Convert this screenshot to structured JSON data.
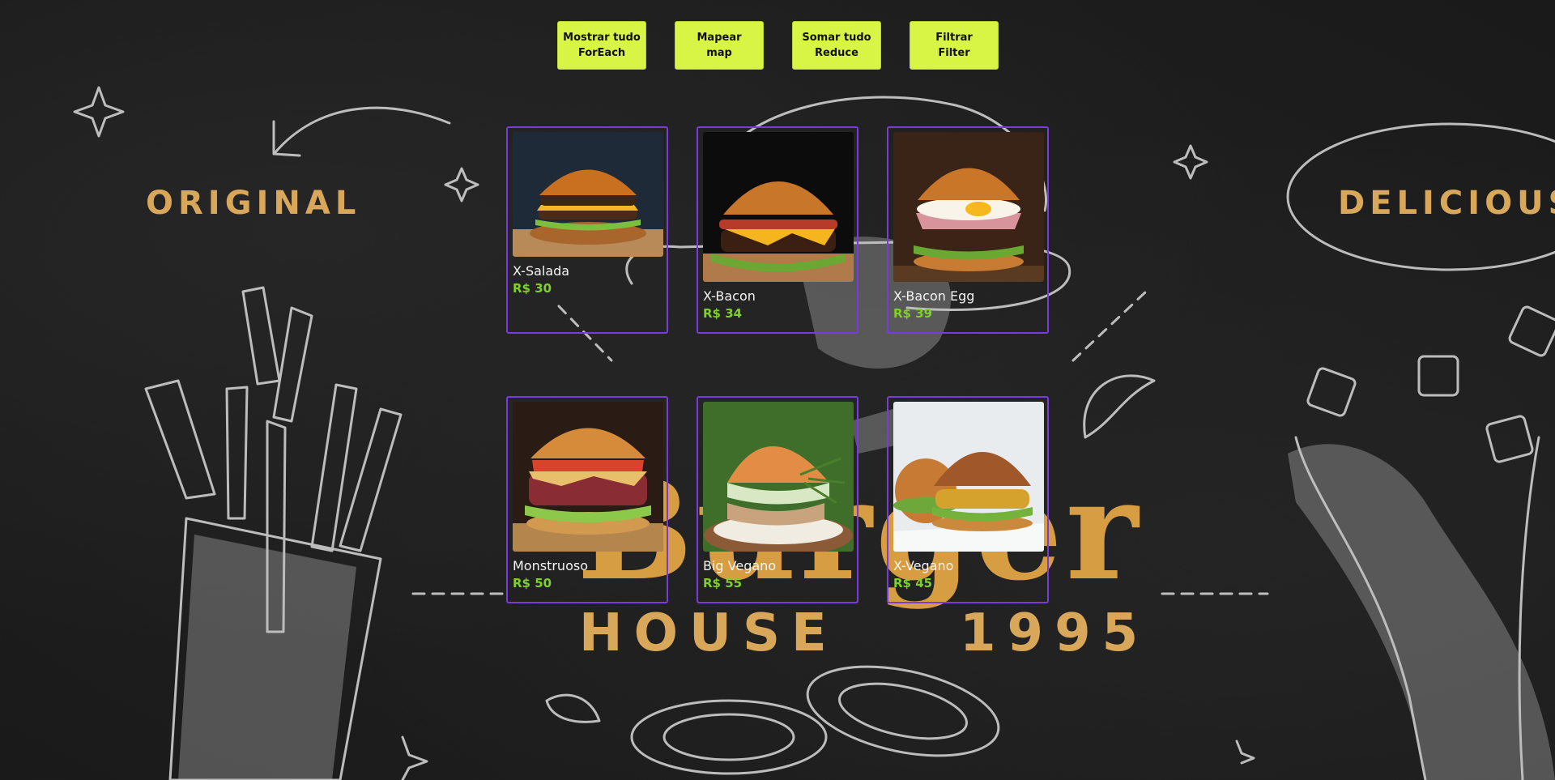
{
  "colors": {
    "button_bg": "#d8f545",
    "card_border": "#7b3bdb",
    "price_text": "#7fd12a",
    "background": "#1d1d1d",
    "chalk_accent": "#d9a75a"
  },
  "background_art": {
    "word_original": "ORIGINAL",
    "word_delicious": "DELICIOUS",
    "word_burger": "Burger",
    "word_house": "HOUSE",
    "word_year": "1995"
  },
  "buttons": [
    {
      "line1": "Mostrar tudo",
      "line2": "ForEach"
    },
    {
      "line1": "Mapear",
      "line2": "map"
    },
    {
      "line1": "Somar tudo",
      "line2": "Reduce"
    },
    {
      "line1": "Filtrar",
      "line2": "Filter"
    }
  ],
  "products": [
    {
      "name": "X-Salada",
      "price": "R$ 30",
      "photo_icon": "burger-salad-photo"
    },
    {
      "name": "X-Bacon",
      "price": "R$ 34",
      "photo_icon": "burger-bacon-photo"
    },
    {
      "name": "X-Bacon Egg",
      "price": "R$ 39",
      "photo_icon": "burger-bacon-egg-photo"
    },
    {
      "name": "Monstruoso",
      "price": "R$ 50",
      "photo_icon": "burger-monster-photo"
    },
    {
      "name": "Big Vegano",
      "price": "R$ 55",
      "photo_icon": "burger-big-vegan-photo"
    },
    {
      "name": "X-Vegano",
      "price": "R$ 45",
      "photo_icon": "burger-vegan-photo"
    }
  ]
}
